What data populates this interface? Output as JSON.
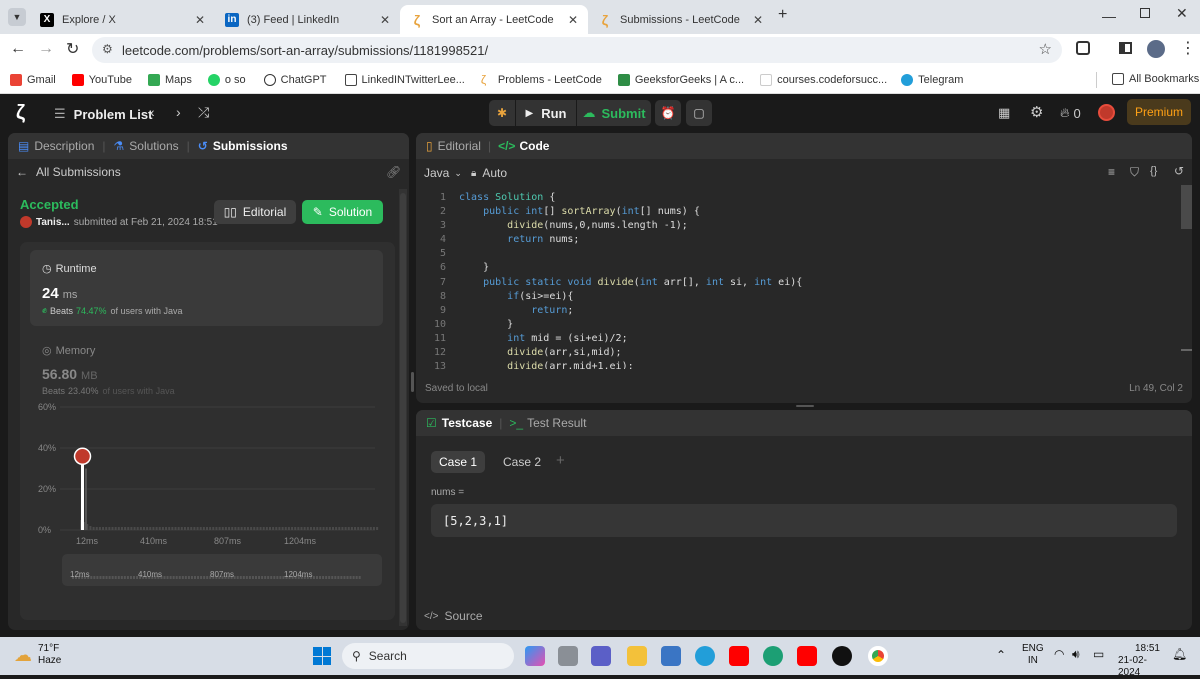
{
  "tabs": [
    {
      "title": "Explore / X",
      "icon": "x-icon"
    },
    {
      "title": "(3) Feed | LinkedIn",
      "icon": "linkedin-icon"
    },
    {
      "title": "Sort an Array - LeetCode",
      "icon": "leetcode-icon"
    },
    {
      "title": "Submissions - LeetCode",
      "icon": "leetcode-icon"
    }
  ],
  "address": {
    "url": "leetcode.com/problems/sort-an-array/submissions/1181998521/"
  },
  "bookmarks": [
    "Gmail",
    "YouTube",
    "Maps",
    "o so",
    "ChatGPT",
    "LinkedINTwitterLee...",
    "Problems - LeetCode",
    "GeeksforGeeks | A c...",
    "courses.codeforsucc...",
    "Telegram"
  ],
  "all_bookmarks": "All Bookmarks",
  "header": {
    "problem_list": "Problem List",
    "run": "Run",
    "submit": "Submit",
    "fire_count": "0",
    "premium": "Premium"
  },
  "left_tabs": {
    "description": "Description",
    "solutions": "Solutions",
    "submissions": "Submissions"
  },
  "submission": {
    "back": "All Submissions",
    "status": "Accepted",
    "user": "Tanis...",
    "submitted": "submitted at Feb 21, 2024 18:51",
    "editorial_btn": "Editorial",
    "solution_btn": "Solution",
    "runtime_label": "Runtime",
    "runtime_value": "24",
    "runtime_unit": "ms",
    "runtime_beats_label": "Beats",
    "runtime_beats": "74.47%",
    "runtime_beats_suffix": "of users with Java",
    "memory_label": "Memory",
    "memory_value": "56.80",
    "memory_unit": "MB",
    "memory_beats_label": "Beats",
    "memory_beats": "23.40%",
    "memory_beats_suffix": "of users with Java"
  },
  "chart_data": {
    "type": "bar",
    "yticks": [
      "60%",
      "40%",
      "20%",
      "0%"
    ],
    "xticks": [
      "12ms",
      "410ms",
      "807ms",
      "1204ms"
    ],
    "ylim": [
      0,
      60
    ],
    "highlight_value": 34,
    "highlight_x": "12ms"
  },
  "editor_tabs": {
    "editorial": "Editorial",
    "code": "Code"
  },
  "editor": {
    "language": "Java",
    "mode": "Auto",
    "status": "Saved to local",
    "position": "Ln 49, Col 2",
    "lines": [
      "class Solution {",
      "    public int[] sortArray(int[] nums) {",
      "        divide(nums,0,nums.length -1);",
      "        return nums;",
      "",
      "    }",
      "    public static void divide(int arr[], int si, int ei){",
      "        if(si>=ei){",
      "            return;",
      "        }",
      "        int mid = (si+ei)/2;",
      "        divide(arr,si,mid);",
      "        divide(arr,mid+1,ei);"
    ]
  },
  "testcase": {
    "tab": "Testcase",
    "result_tab": "Test Result",
    "case1": "Case 1",
    "case2": "Case 2",
    "var_label": "nums =",
    "var_value": "[5,2,3,1]",
    "source": "Source"
  },
  "taskbar": {
    "temp": "71°F",
    "weather": "Haze",
    "search": "Search",
    "lang1": "ENG",
    "lang2": "IN",
    "time": "18:51",
    "date": "21-02-2024"
  },
  "colors": {
    "accepted": "#2cbb5d",
    "accent_green": "#2cbb5d",
    "premium": "#ffa116"
  }
}
